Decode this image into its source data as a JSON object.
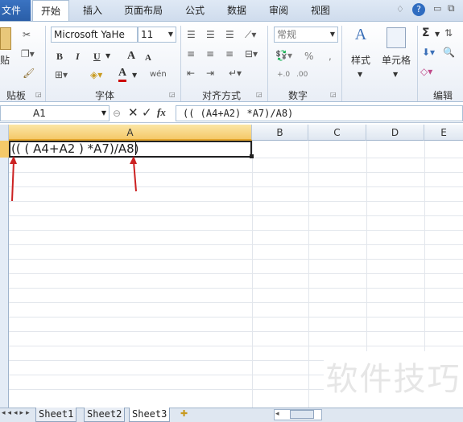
{
  "tabs": {
    "file": "文件",
    "home": "开始",
    "insert": "插入",
    "page_layout": "页面布局",
    "formulas": "公式",
    "data": "数据",
    "review": "审阅",
    "view": "视图"
  },
  "ribbon": {
    "clipboard": {
      "paste": "贴",
      "label": "贴板"
    },
    "font": {
      "name": "Microsoft YaHe",
      "size": "11",
      "bold": "B",
      "italic": "I",
      "underline": "U",
      "grow": "A",
      "shrink": "A",
      "font_color": "A",
      "wen": "wén",
      "label": "字体"
    },
    "alignment": {
      "label": "对齐方式"
    },
    "number": {
      "format": "常规",
      "percent": "%",
      "comma": ",",
      "label": "数字"
    },
    "styles": {
      "label": "样式"
    },
    "cells": {
      "label": "单元格"
    },
    "editing": {
      "sigma": "Σ",
      "label": "编辑"
    }
  },
  "formula_bar": {
    "name_box": "A1",
    "fx": "fx",
    "formula": "(( (A4+A2) *A7)/A8)"
  },
  "columns": [
    "A",
    "B",
    "C",
    "D",
    "E"
  ],
  "cell_a1": "(( ( A4+A2 ) *A7)/A8)",
  "sheets": [
    "Sheet1",
    "Sheet2",
    "Sheet3"
  ],
  "watermark": "软件技巧",
  "colors": {
    "file_tab": "#2a5ea8",
    "ribbon_bg": "#e9eef6",
    "arrow": "#cc2222",
    "font_color_bar": "#cc0000"
  }
}
